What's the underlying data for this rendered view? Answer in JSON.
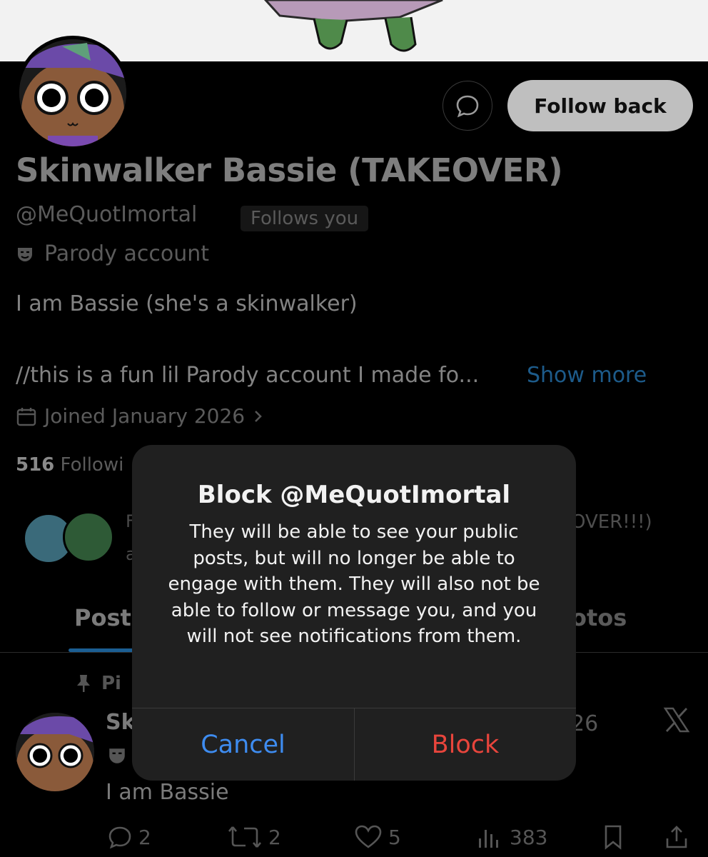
{
  "profile": {
    "display_name": "Skinwalker Bassie (TAKEOVER)",
    "handle": "@MeQuotImortal",
    "follows_you": "Follows you",
    "parody_label": "Parody account",
    "bio_line1": "I am Bassie (she's a skinwalker)",
    "bio_line2": "//this is a fun lil Parody account I made fo...",
    "show_more": "Show more",
    "joined": "Joined January 2026",
    "following_count": "516",
    "following_label": "Followi",
    "follow_back_label": "Follow back"
  },
  "mutuals": {
    "left_fragment_1": "F",
    "left_fragment_2": "a",
    "right_fragment": "OVER!!!)"
  },
  "tabs": {
    "posts_fragment": "Post",
    "photos_fragment": "otos"
  },
  "pinned_post": {
    "pinned_fragment": "Pi",
    "name_fragment": "Sk",
    "date_fragment": "26",
    "text": "I am Bassie",
    "replies": "2",
    "reposts": "2",
    "likes": "5",
    "views": "383"
  },
  "dialog": {
    "title": "Block @MeQuotImortal",
    "message": "They will be able to see your public posts, but will no longer be able to engage with them. They will also not be able to follow or message you, and you will not see notifications from them.",
    "cancel_label": "Cancel",
    "block_label": "Block"
  },
  "colors": {
    "dialog_background": "#202020",
    "cancel": "#3e8cf0",
    "block": "#e8453c",
    "link": "#1d5b8a"
  }
}
